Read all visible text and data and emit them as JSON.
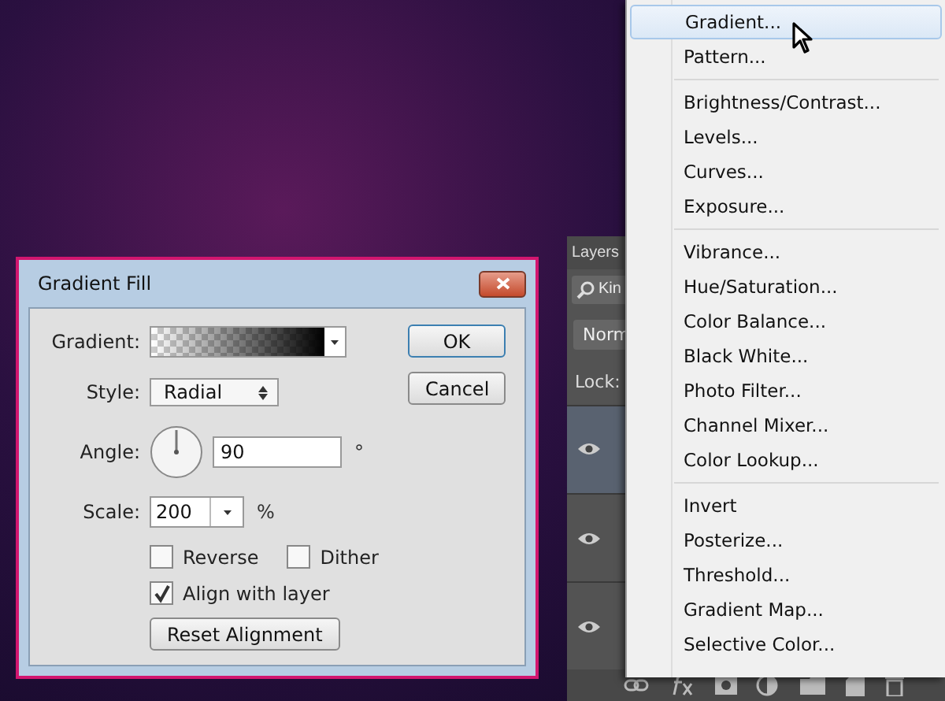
{
  "layers_panel": {
    "tab": "Layers",
    "search": {
      "value": "Kin"
    },
    "blend_mode": {
      "value": "Norm"
    },
    "lock_label": "Lock:",
    "layers": [
      {
        "visible": true,
        "selected": true
      },
      {
        "visible": true,
        "selected": false
      },
      {
        "visible": true,
        "selected": false
      }
    ]
  },
  "menu": {
    "groups": [
      [
        {
          "label": "Gradient...",
          "selected": true
        },
        {
          "label": "Pattern...",
          "selected": false
        }
      ],
      [
        {
          "label": "Brightness/Contrast...",
          "selected": false
        },
        {
          "label": "Levels...",
          "selected": false
        },
        {
          "label": "Curves...",
          "selected": false
        },
        {
          "label": "Exposure...",
          "selected": false
        }
      ],
      [
        {
          "label": "Vibrance...",
          "selected": false
        },
        {
          "label": "Hue/Saturation...",
          "selected": false
        },
        {
          "label": "Color Balance...",
          "selected": false
        },
        {
          "label": "Black  White...",
          "selected": false
        },
        {
          "label": "Photo Filter...",
          "selected": false
        },
        {
          "label": "Channel Mixer...",
          "selected": false
        },
        {
          "label": "Color Lookup...",
          "selected": false
        }
      ],
      [
        {
          "label": "Invert",
          "selected": false
        },
        {
          "label": "Posterize...",
          "selected": false
        },
        {
          "label": "Threshold...",
          "selected": false
        },
        {
          "label": "Gradient Map...",
          "selected": false
        },
        {
          "label": "Selective Color...",
          "selected": false
        }
      ]
    ]
  },
  "dialog": {
    "title": "Gradient Fill",
    "gradient_label": "Gradient:",
    "style_label": "Style:",
    "style": {
      "value": "Radial"
    },
    "angle_label": "Angle:",
    "angle": {
      "value": "90"
    },
    "degree_sign": "°",
    "scale_label": "Scale:",
    "scale": {
      "value": "200"
    },
    "percent_sign": "%",
    "options": [
      {
        "label": "Reverse",
        "checked": false
      },
      {
        "label": "Dither",
        "checked": false
      },
      {
        "label": "Align with layer",
        "checked": true
      }
    ],
    "reset_button": "Reset Alignment",
    "ok_button": "OK",
    "cancel_button": "Cancel"
  }
}
